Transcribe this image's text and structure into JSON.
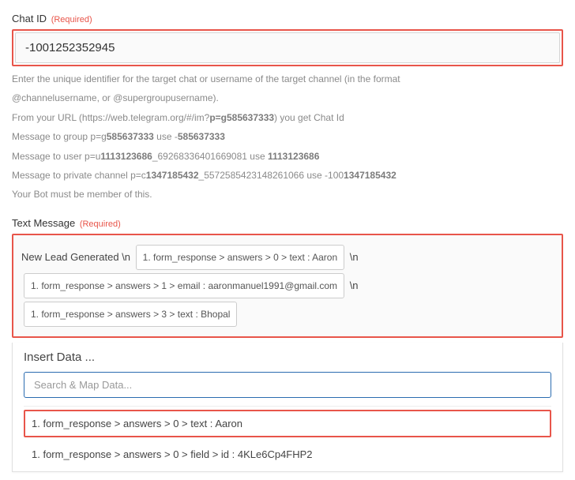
{
  "chatId": {
    "label": "Chat ID",
    "requiredText": "(Required)",
    "value": "-1001252352945",
    "help1_a": "Enter the unique identifier for the target chat or username of the target channel (in the format",
    "help1_b": "@channelusername, or @supergroupusername).",
    "help2_a": "From your URL (https://web.telegram.org/#/im?",
    "help2_strong_a": "p=g585637333",
    "help2_b": ") you get Chat Id",
    "help3_a": "Message to group p=g",
    "help3_strong_a": "585637333",
    "help3_b": " use -",
    "help3_strong_b": "585637333",
    "help4_a": "Message to user p=u",
    "help4_strong_a": "1113123686",
    "help4_b": "_69268336401669081 use ",
    "help4_strong_b": "1113123686",
    "help5_a": "Message to private channel p=c",
    "help5_strong_a": "1347185432",
    "help5_b": "_5572585423148261066 use -100",
    "help5_strong_b": "1347185432",
    "help6": "Your Bot must be member of this."
  },
  "textMessage": {
    "label": "Text Message",
    "requiredText": "(Required)",
    "prefixText": "New Lead Generated \\n",
    "pill1": "1. form_response > answers > 0 > text : Aaron",
    "sep1": "\\n",
    "pill2": "1. form_response > answers > 1 > email : aaronmanuel1991@gmail.com",
    "sep2": "\\n",
    "pill3": "1. form_response > answers > 3 > text : Bhopal"
  },
  "insertPanel": {
    "title": "Insert Data ...",
    "searchPlaceholder": "Search & Map Data...",
    "option1": "1. form_response > answers > 0 > text : Aaron",
    "option2": "1. form_response > answers > 0 > field > id : 4KLe6Cp4FHP2"
  }
}
